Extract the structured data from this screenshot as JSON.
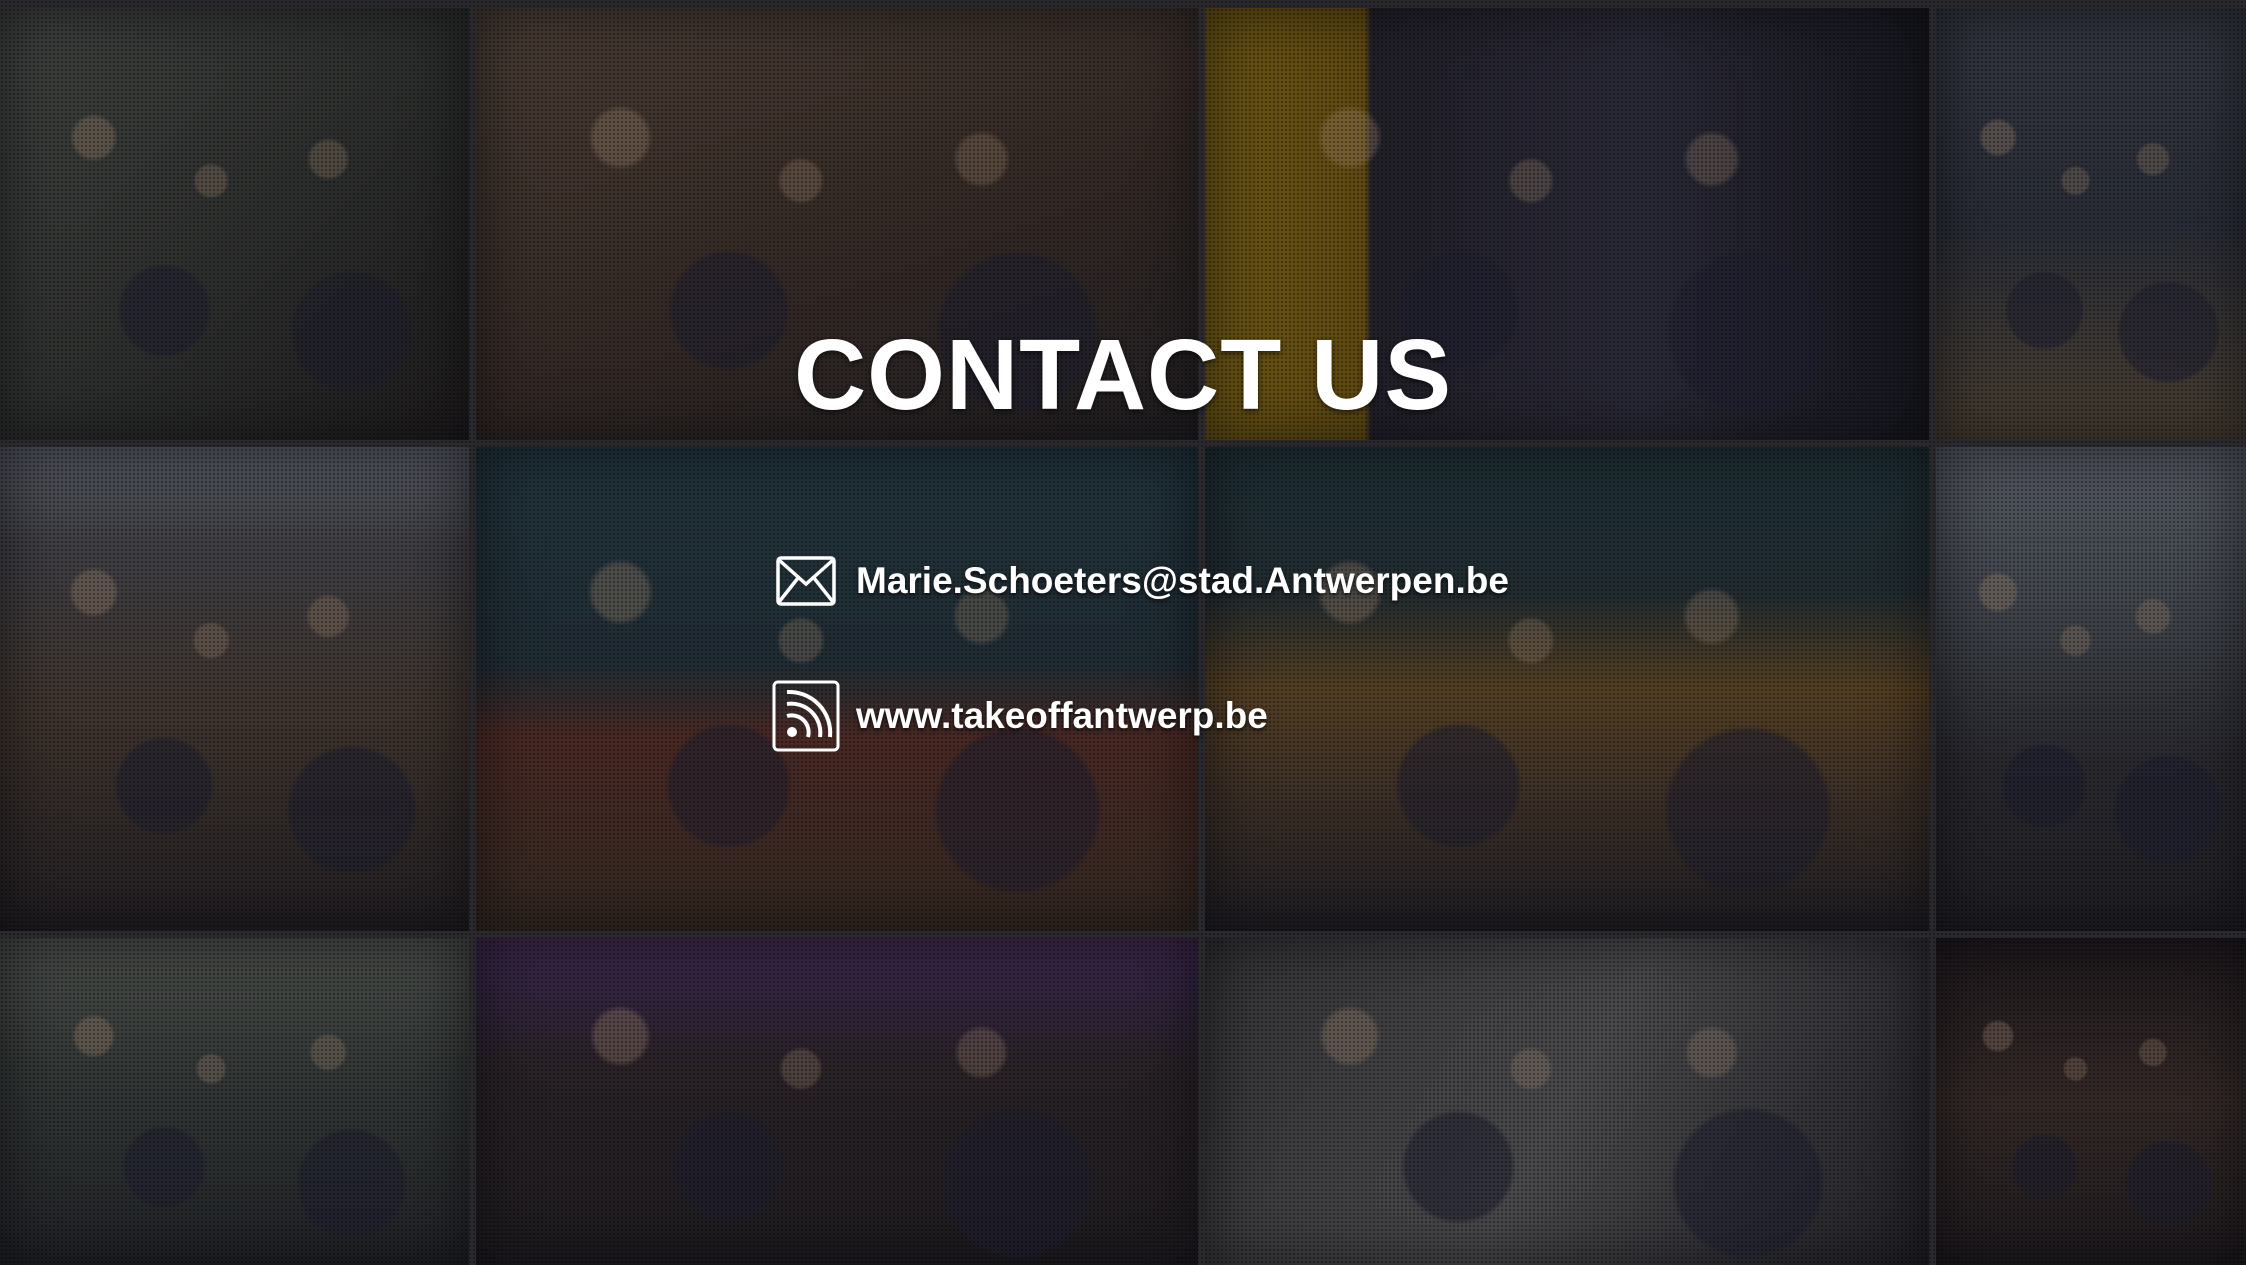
{
  "page": {
    "title": "CONTACT US"
  },
  "contact": {
    "email": {
      "icon": "envelope-icon",
      "text": "Marie.Schoeters@stad.Antwerpen.be"
    },
    "website": {
      "icon": "rss-feed-icon",
      "text": "www.takeoffantwerp.be"
    }
  },
  "background": {
    "tile_colors": [
      "#4a4d44",
      "#5a4a3c",
      "#6b5a1e",
      "#3e4450",
      "#4b4a48",
      "#3a4f52",
      "#3d4a4d",
      "#5a6064",
      "#3e4548",
      "#4a3a58",
      "#4d5050",
      "#4e4540"
    ]
  }
}
